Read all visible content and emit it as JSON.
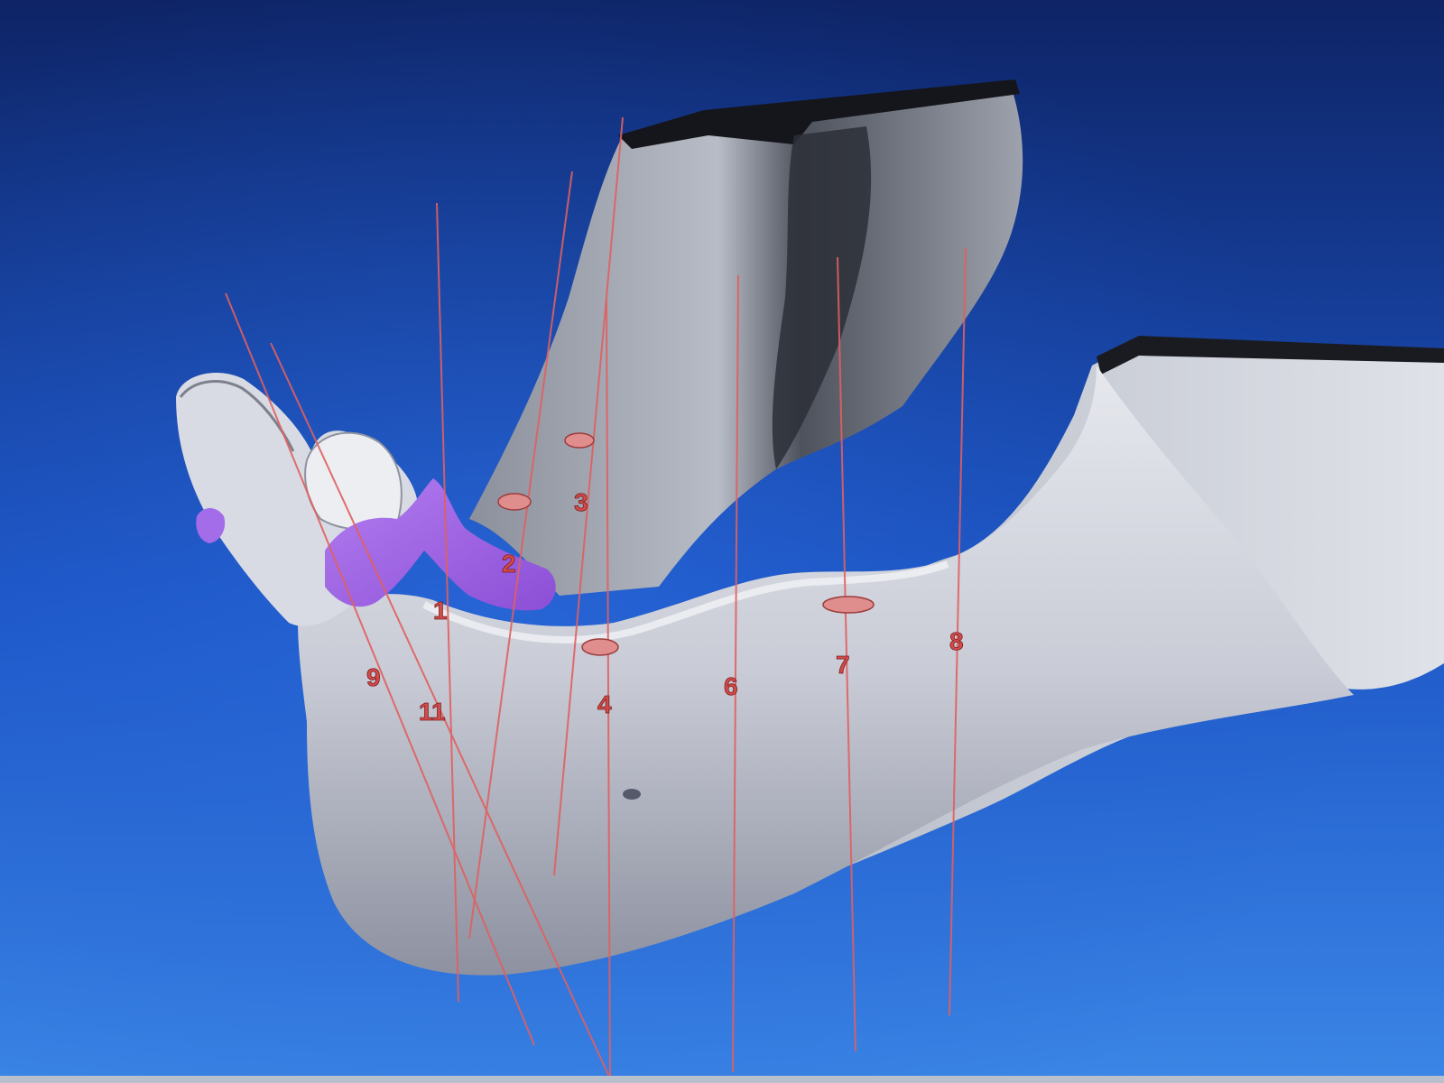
{
  "viewer": {
    "colors": {
      "background_top": "#0e2466",
      "background_mid": "#1d56c7",
      "background_bottom": "#3b86e6",
      "bone": "#cfd3dc",
      "bone_shadow": "#6c7080",
      "gingiva": "#a56be8",
      "implant_line": "#e06060",
      "implant_cap": "#e08d8d",
      "label": "#d24a4a"
    },
    "markers": [
      {
        "id": "1",
        "label": "1"
      },
      {
        "id": "2",
        "label": "2"
      },
      {
        "id": "3",
        "label": "3"
      },
      {
        "id": "4",
        "label": "4"
      },
      {
        "id": "6",
        "label": "6"
      },
      {
        "id": "7",
        "label": "7"
      },
      {
        "id": "8",
        "label": "8"
      },
      {
        "id": "9",
        "label": "9"
      },
      {
        "id": "11",
        "label": "11"
      }
    ]
  }
}
